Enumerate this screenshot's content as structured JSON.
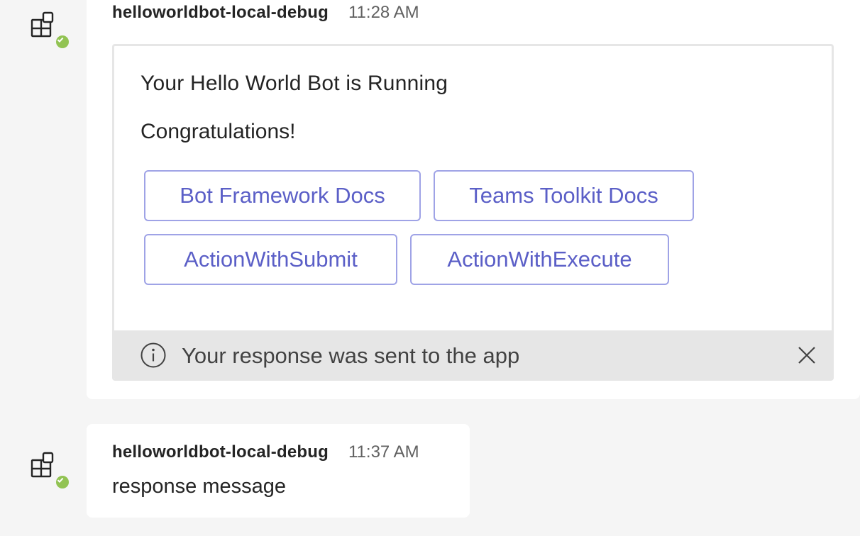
{
  "messages": [
    {
      "sender": "helloworldbot-local-debug",
      "time": "11:28 AM",
      "avatar_icon": "app-icon",
      "presence": "available",
      "card": {
        "title": "Your Hello World Bot is Running",
        "text": "Congratulations!",
        "actions": [
          {
            "label": "Bot Framework Docs"
          },
          {
            "label": "Teams Toolkit Docs"
          },
          {
            "label": "ActionWithSubmit"
          },
          {
            "label": "ActionWithExecute"
          }
        ],
        "footer": {
          "icon": "info-icon",
          "text": "Your response was sent to the app",
          "close_icon": "close-icon"
        }
      }
    },
    {
      "sender": "helloworldbot-local-debug",
      "time": "11:37 AM",
      "avatar_icon": "app-icon",
      "presence": "available",
      "text": "response message"
    }
  ],
  "colors": {
    "accent": "#5b5fc7",
    "button_border": "#9fa3e6",
    "presence_available": "#92c353",
    "page_background": "#f5f5f5",
    "footer_background": "#e6e6e6"
  }
}
